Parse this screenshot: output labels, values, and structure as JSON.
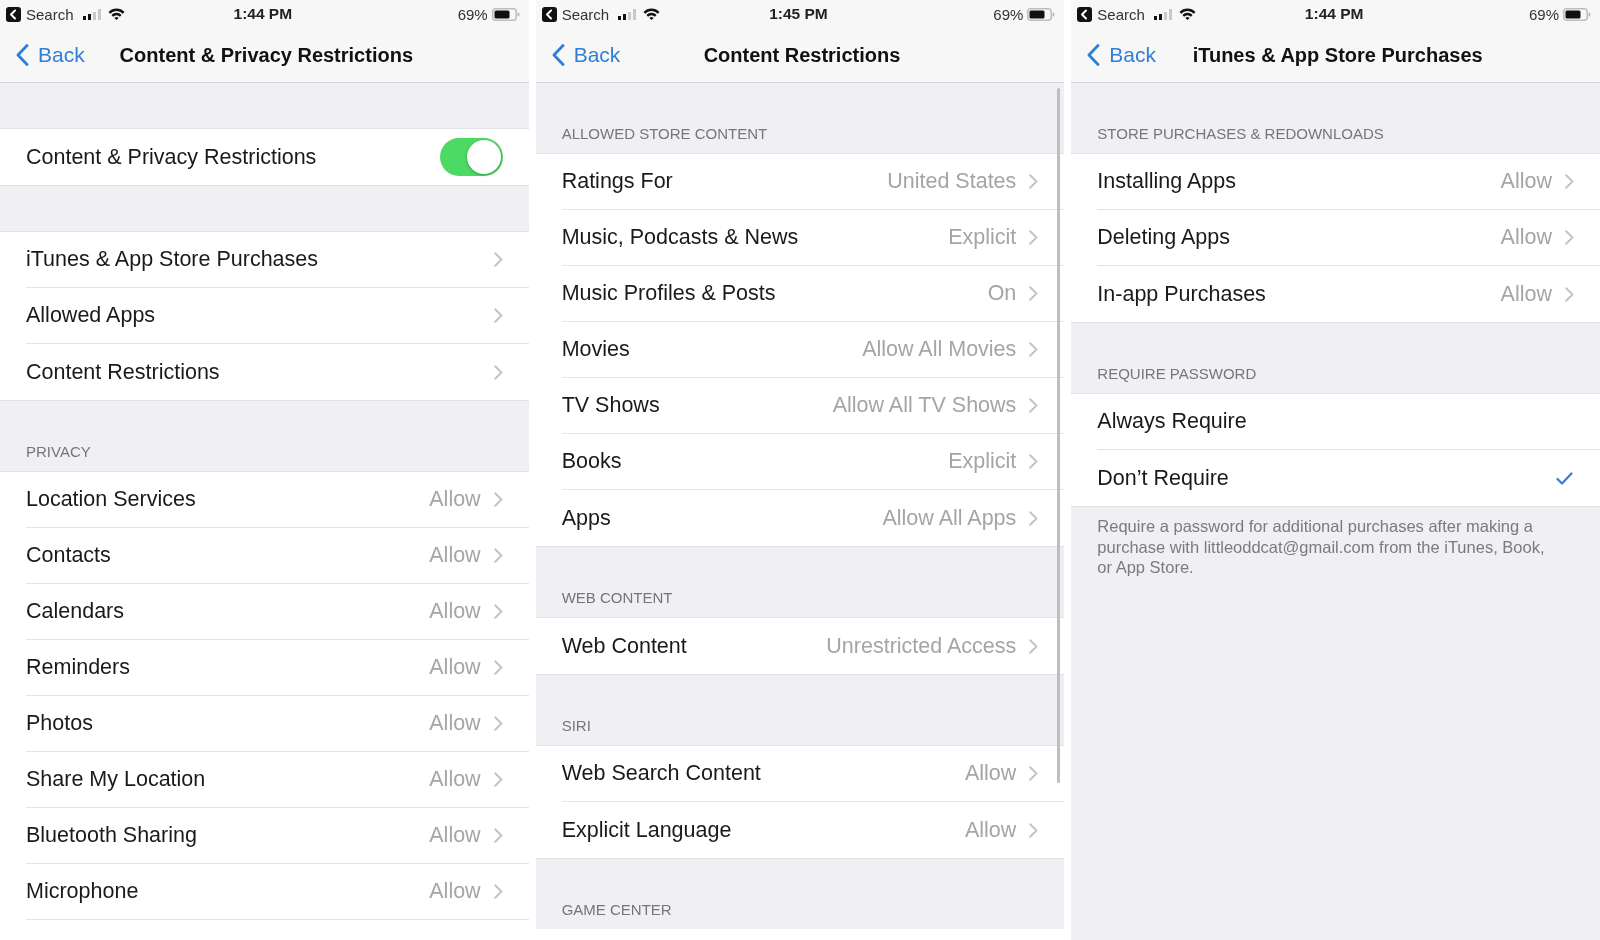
{
  "screens": [
    {
      "status_bar": {
        "back_app": "Search",
        "time": "1:44 PM",
        "battery": "69%"
      },
      "nav": {
        "back": "Back",
        "title": "Content & Privacy Restrictions"
      },
      "groups": [
        {
          "rows": [
            {
              "kind": "toggle",
              "label": "Content & Privacy Restrictions",
              "on": true
            }
          ]
        },
        {
          "rows": [
            {
              "kind": "link",
              "label": "iTunes & App Store Purchases"
            },
            {
              "kind": "link",
              "label": "Allowed Apps"
            },
            {
              "kind": "link",
              "label": "Content Restrictions"
            }
          ]
        },
        {
          "header": "PRIVACY",
          "more_below": true,
          "rows": [
            {
              "kind": "link",
              "label": "Location Services",
              "value": "Allow"
            },
            {
              "kind": "link",
              "label": "Contacts",
              "value": "Allow"
            },
            {
              "kind": "link",
              "label": "Calendars",
              "value": "Allow"
            },
            {
              "kind": "link",
              "label": "Reminders",
              "value": "Allow"
            },
            {
              "kind": "link",
              "label": "Photos",
              "value": "Allow"
            },
            {
              "kind": "link",
              "label": "Share My Location",
              "value": "Allow"
            },
            {
              "kind": "link",
              "label": "Bluetooth Sharing",
              "value": "Allow"
            },
            {
              "kind": "link",
              "label": "Microphone",
              "value": "Allow"
            }
          ]
        }
      ]
    },
    {
      "status_bar": {
        "back_app": "Search",
        "time": "1:45 PM",
        "battery": "69%"
      },
      "nav": {
        "back": "Back",
        "title": "Content Restrictions"
      },
      "scroll_indicator": true,
      "groups": [
        {
          "header": "ALLOWED STORE CONTENT",
          "rows": [
            {
              "kind": "link",
              "label": "Ratings For",
              "value": "United States"
            },
            {
              "kind": "link",
              "label": "Music, Podcasts & News",
              "value": "Explicit"
            },
            {
              "kind": "link",
              "label": "Music Profiles & Posts",
              "value": "On"
            },
            {
              "kind": "link",
              "label": "Movies",
              "value": "Allow All Movies"
            },
            {
              "kind": "link",
              "label": "TV Shows",
              "value": "Allow All TV Shows"
            },
            {
              "kind": "link",
              "label": "Books",
              "value": "Explicit"
            },
            {
              "kind": "link",
              "label": "Apps",
              "value": "Allow All Apps"
            }
          ]
        },
        {
          "header": "WEB CONTENT",
          "rows": [
            {
              "kind": "link",
              "label": "Web Content",
              "value": "Unrestricted Access"
            }
          ]
        },
        {
          "header": "SIRI",
          "rows": [
            {
              "kind": "link",
              "label": "Web Search Content",
              "value": "Allow"
            },
            {
              "kind": "link",
              "label": "Explicit Language",
              "value": "Allow"
            }
          ]
        },
        {
          "header": "GAME CENTER",
          "more_below": true
        }
      ]
    },
    {
      "status_bar": {
        "back_app": "Search",
        "time": "1:44 PM",
        "battery": "69%"
      },
      "nav": {
        "back": "Back",
        "title": "iTunes & App Store Purchases"
      },
      "groups": [
        {
          "header": "STORE PURCHASES & REDOWNLOADS",
          "rows": [
            {
              "kind": "link",
              "label": "Installing Apps",
              "value": "Allow"
            },
            {
              "kind": "link",
              "label": "Deleting Apps",
              "value": "Allow"
            },
            {
              "kind": "link",
              "label": "In-app Purchases",
              "value": "Allow"
            }
          ]
        },
        {
          "header": "REQUIRE PASSWORD",
          "rows": [
            {
              "kind": "option",
              "label": "Always Require",
              "selected": false
            },
            {
              "kind": "option",
              "label": "Don’t Require",
              "selected": true
            }
          ],
          "footer": "Require a password for additional purchases after making a purchase with littleoddcat@gmail.com from the iTunes, Book, or App Store."
        }
      ]
    }
  ]
}
